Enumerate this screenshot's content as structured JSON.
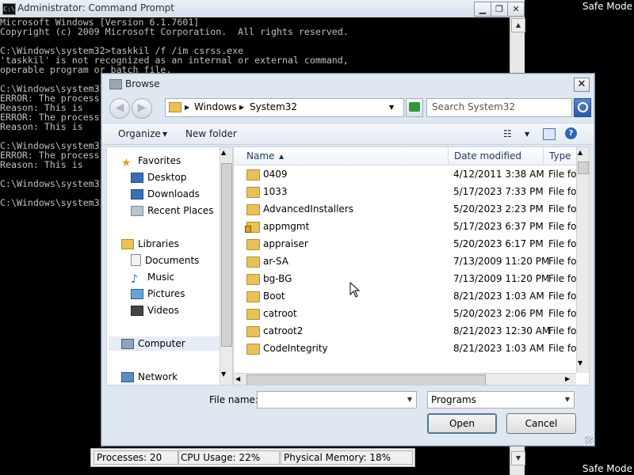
{
  "desktop": {
    "safe_mode_top": "Safe Mode",
    "safe_mode_bottom": "Safe Mode"
  },
  "cmd": {
    "title": "Administrator: Command Prompt",
    "icon_text": "C:\\",
    "lines": [
      "Microsoft Windows [Version 6.1.7601]",
      "Copyright (c) 2009 Microsoft Corporation.  All rights reserved.",
      "",
      "C:\\Windows\\system32>taskkil /f /im csrss.exe",
      "'taskkil' is not recognized as an internal or external command,",
      "operable program or batch file.",
      "",
      "C:\\Windows\\system32>",
      "ERROR: The process",
      "Reason: This is",
      "ERROR: The process",
      "Reason: This is",
      "",
      "C:\\Windows\\system32>",
      "ERROR: The process",
      "Reason: This is",
      "",
      "C:\\Windows\\system32>",
      "",
      "C:\\Windows\\system32>"
    ]
  },
  "status_bar": {
    "processes": "Processes: 20",
    "cpu": "CPU Usage: 22%",
    "memory": "Physical Memory: 18%"
  },
  "dialog": {
    "title": "Browse",
    "close_label": "✕",
    "address": {
      "crumb1": "Windows",
      "crumb2": "System32"
    },
    "search_placeholder": "Search System32",
    "toolbar": {
      "organize": "Organize",
      "new_folder": "New folder"
    },
    "nav": {
      "favorites": "Favorites",
      "desktop": "Desktop",
      "downloads": "Downloads",
      "recent": "Recent Places",
      "libraries": "Libraries",
      "documents": "Documents",
      "music": "Music",
      "pictures": "Pictures",
      "videos": "Videos",
      "computer": "Computer",
      "network": "Network"
    },
    "columns": {
      "name": "Name",
      "date": "Date modified",
      "type": "Type"
    },
    "files": [
      {
        "name": "0409",
        "date": "4/12/2011 3:38 AM",
        "type": "File fol",
        "locked": false
      },
      {
        "name": "1033",
        "date": "5/17/2023 7:33 PM",
        "type": "File fol",
        "locked": false
      },
      {
        "name": "AdvancedInstallers",
        "date": "5/20/2023 2:23 PM",
        "type": "File fol",
        "locked": false
      },
      {
        "name": "appmgmt",
        "date": "5/17/2023 6:37 PM",
        "type": "File fol",
        "locked": true
      },
      {
        "name": "appraiser",
        "date": "5/20/2023 6:17 PM",
        "type": "File fol",
        "locked": false
      },
      {
        "name": "ar-SA",
        "date": "7/13/2009 11:20 PM",
        "type": "File fol",
        "locked": false
      },
      {
        "name": "bg-BG",
        "date": "7/13/2009 11:20 PM",
        "type": "File fol",
        "locked": false
      },
      {
        "name": "Boot",
        "date": "8/21/2023 1:03 AM",
        "type": "File fol",
        "locked": false
      },
      {
        "name": "catroot",
        "date": "5/20/2023 2:06 PM",
        "type": "File fol",
        "locked": false
      },
      {
        "name": "catroot2",
        "date": "8/21/2023 12:30 AM",
        "type": "File fol",
        "locked": false
      },
      {
        "name": "CodeIntegrity",
        "date": "8/21/2023 1:03 AM",
        "type": "File fol",
        "locked": false
      }
    ],
    "file_name_label": "File name:",
    "file_name_value": "",
    "file_type_value": "Programs",
    "open_label": "Open",
    "cancel_label": "Cancel"
  }
}
